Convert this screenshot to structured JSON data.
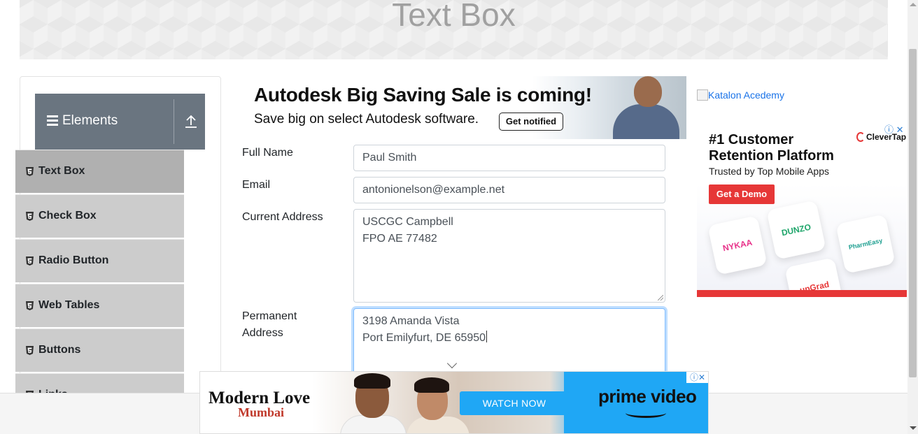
{
  "header": {
    "title": "Text Box"
  },
  "sidebar": {
    "group_title": "Elements",
    "items": [
      {
        "label": "Text Box",
        "active": true
      },
      {
        "label": "Check Box",
        "active": false
      },
      {
        "label": "Radio Button",
        "active": false
      },
      {
        "label": "Web Tables",
        "active": false
      },
      {
        "label": "Buttons",
        "active": false
      },
      {
        "label": "Links",
        "active": false
      }
    ]
  },
  "form": {
    "full_name": {
      "label": "Full Name",
      "value": "Paul Smith"
    },
    "email": {
      "label": "Email",
      "value": "antonionelson@example.net"
    },
    "current_address": {
      "label": "Current Address",
      "line1": "USCGC Campbell",
      "line2": "FPO AE 77482"
    },
    "permanent_address": {
      "label_line1": "Permanent",
      "label_line2": "Address",
      "line1": "3198 Amanda Vista",
      "line2": "Port Emilyfurt, DE 65950"
    }
  },
  "ads": {
    "autodesk": {
      "headline": "Autodesk Big Saving Sale is coming!",
      "sub": "Save big on select Autodesk software.",
      "button": "Get notified"
    },
    "katalon": {
      "alt_text": "Katalon Acedemy"
    },
    "clevertap": {
      "headline": "#1 Customer Retention Platform",
      "sub": "Trusted by Top Mobile Apps",
      "button": "Get a Demo",
      "brand": "CleverTap",
      "close": "ⓘ ✕",
      "tiles": [
        "NYKAA",
        "DUNZO",
        "PharmEasy",
        "upGrad"
      ]
    },
    "prime": {
      "title": "Modern Love",
      "subtitle": "Mumbai",
      "button": "WATCH NOW",
      "brand": "prime video",
      "choices": "ⓘ✕"
    }
  },
  "colors": {
    "accent": "#6a7580",
    "menu": "#cccccc",
    "menu_active": "#b0b0b0",
    "prime_blue": "#1fa7f5",
    "clevertap_red": "#e63737"
  }
}
